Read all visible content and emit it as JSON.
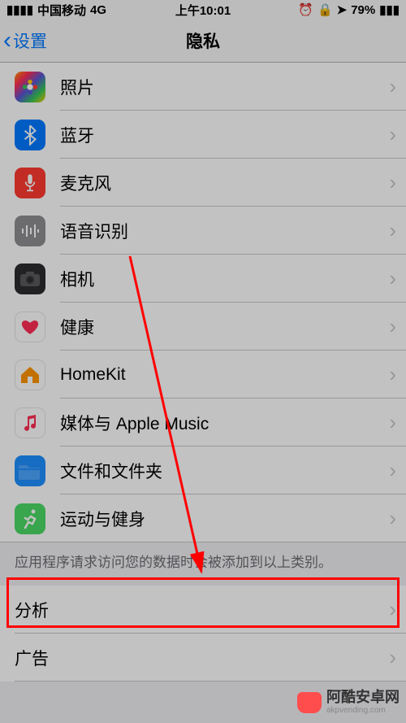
{
  "status": {
    "carrier": "中国移动",
    "network": "4G",
    "time": "上午10:01",
    "battery": "79%"
  },
  "nav": {
    "back": "设置",
    "title": "隐私"
  },
  "items": [
    {
      "key": "photos",
      "label": "照片"
    },
    {
      "key": "bluetooth",
      "label": "蓝牙"
    },
    {
      "key": "mic",
      "label": "麦克风"
    },
    {
      "key": "speech",
      "label": "语音识别"
    },
    {
      "key": "camera",
      "label": "相机"
    },
    {
      "key": "health",
      "label": "健康"
    },
    {
      "key": "homekit",
      "label": "HomeKit"
    },
    {
      "key": "music",
      "label": "媒体与 Apple Music"
    },
    {
      "key": "files",
      "label": "文件和文件夹"
    },
    {
      "key": "activity",
      "label": "运动与健身"
    }
  ],
  "footer_note": "应用程序请求访问您的数据时会被添加到以上类别。",
  "group2": {
    "analytics": "分析",
    "ads": "广告"
  },
  "watermark": {
    "main": "阿酷安卓网",
    "sub": "akpvending.com"
  }
}
